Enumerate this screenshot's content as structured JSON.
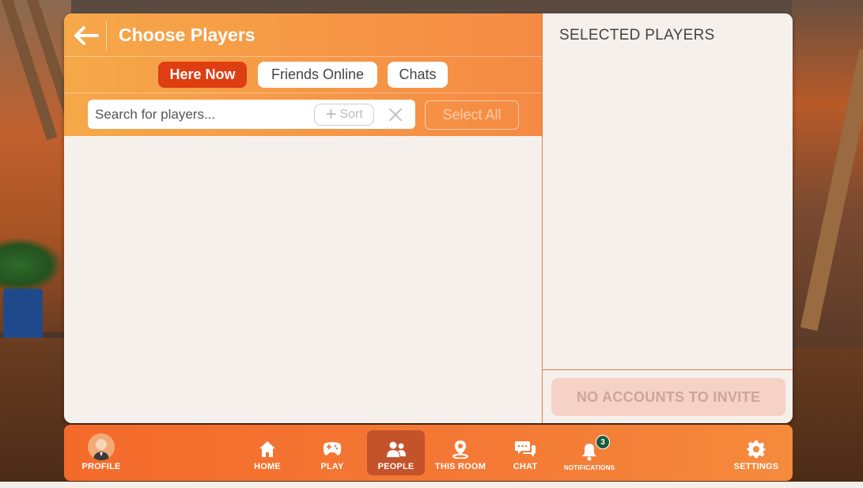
{
  "header": {
    "title": "Choose Players",
    "back_icon": "back-arrow-icon"
  },
  "tabs": [
    {
      "label": "Here Now",
      "active": true
    },
    {
      "label": "Friends Online",
      "active": false
    },
    {
      "label": "Chats",
      "active": false
    }
  ],
  "search": {
    "placeholder": "Search for players...",
    "value": "",
    "sort_label": "Sort",
    "select_all_label": "Select All"
  },
  "selected": {
    "title": "SELECTED PLAYERS",
    "invite_label": "NO ACCOUNTS TO INVITE"
  },
  "nav": {
    "profile": "PROFILE",
    "home": "HOME",
    "play": "PLAY",
    "people": "PEOPLE",
    "this_room": "THIS ROOM",
    "chat": "CHAT",
    "notifications": "NOTIFICATIONS",
    "notifications_count": "3",
    "settings": "SETTINGS",
    "active": "people"
  },
  "colors": {
    "accent_orange": "#f58a44",
    "active_tab": "#df3d12",
    "panel_bg": "#f5f0ec",
    "badge": "#1a5a3a"
  }
}
